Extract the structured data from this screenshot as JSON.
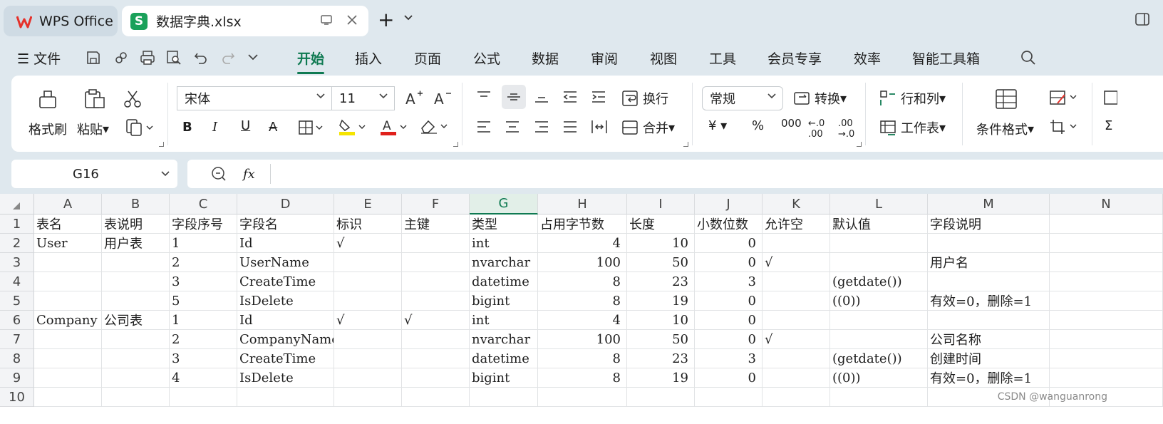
{
  "tabs": {
    "app_label": "WPS Office",
    "file_label": "数据字典.xlsx"
  },
  "menu": {
    "file_label": "文件",
    "items": [
      "开始",
      "插入",
      "页面",
      "公式",
      "数据",
      "审阅",
      "视图",
      "工具",
      "会员专享",
      "效率",
      "智能工具箱"
    ],
    "active": "开始"
  },
  "ribbon": {
    "format_painter": "格式刷",
    "paste": "粘贴",
    "font_name": "宋体",
    "font_size": "11",
    "wrap_text": "换行",
    "merge": "合并",
    "number_format": "常规",
    "convert": "转换",
    "rows_cols": "行和列",
    "worksheet": "工作表",
    "conditional_format": "条件格式"
  },
  "formula_bar": {
    "cell_ref": "G16",
    "fx": "fx",
    "value": ""
  },
  "grid": {
    "columns": [
      "A",
      "B",
      "C",
      "D",
      "E",
      "F",
      "G",
      "H",
      "I",
      "J",
      "K",
      "L",
      "M",
      "N"
    ],
    "selected_column": "G",
    "row_numbers": [
      "1",
      "2",
      "3",
      "4",
      "5",
      "6",
      "7",
      "8",
      "9",
      "10"
    ],
    "rows": [
      [
        "表名",
        "表说明",
        "字段序号",
        "字段名",
        "标识",
        "主键",
        "类型",
        "占用字节数",
        "长度",
        "小数位数",
        "允许空",
        "默认值",
        "字段说明",
        ""
      ],
      [
        "User",
        "用户表",
        "1",
        "Id",
        "√",
        "",
        "int",
        "4",
        "10",
        "0",
        "",
        "",
        "",
        ""
      ],
      [
        "",
        "",
        "2",
        "UserName",
        "",
        "",
        "nvarchar",
        "100",
        "50",
        "0",
        "√",
        "",
        "用户名",
        ""
      ],
      [
        "",
        "",
        "3",
        "CreateTime",
        "",
        "",
        "datetime",
        "8",
        "23",
        "3",
        "",
        "(getdate())",
        "",
        ""
      ],
      [
        "",
        "",
        "5",
        "IsDelete",
        "",
        "",
        "bigint",
        "8",
        "19",
        "0",
        "",
        "((0))",
        "有效=0，删除=1",
        ""
      ],
      [
        "Company",
        "公司表",
        "1",
        "Id",
        "√",
        "√",
        "int",
        "4",
        "10",
        "0",
        "",
        "",
        "",
        ""
      ],
      [
        "",
        "",
        "2",
        "CompanyName",
        "",
        "",
        "nvarchar",
        "100",
        "50",
        "0",
        "√",
        "",
        "公司名称",
        ""
      ],
      [
        "",
        "",
        "3",
        "CreateTime",
        "",
        "",
        "datetime",
        "8",
        "23",
        "3",
        "",
        "(getdate())",
        "创建时间",
        ""
      ],
      [
        "",
        "",
        "4",
        "IsDelete",
        "",
        "",
        "bigint",
        "8",
        "19",
        "0",
        "",
        "((0))",
        "有效=0，删除=1",
        ""
      ],
      [
        "",
        "",
        "",
        "",
        "",
        "",
        "",
        "",
        "",
        "",
        "",
        "",
        "",
        ""
      ]
    ]
  },
  "watermark": "CSDN @wanguanrong",
  "colors": {
    "accent": "#0f7a52",
    "excel_green": "#1aa15a",
    "wps_red": "#e5312a",
    "highlight_yellow": "#f5e400",
    "font_red": "#e0201b"
  }
}
